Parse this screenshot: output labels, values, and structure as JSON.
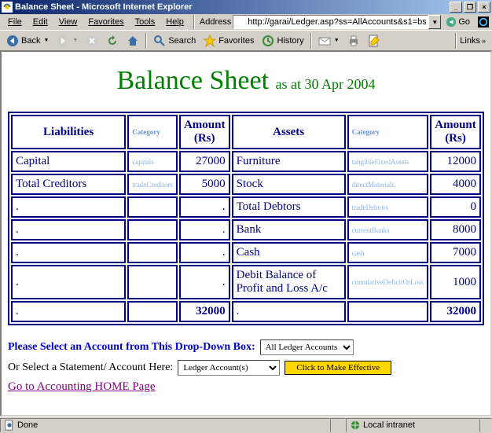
{
  "window": {
    "title": "Balance Sheet - Microsoft Internet Explorer",
    "min": "_",
    "max": "❐",
    "close": "×"
  },
  "menu": {
    "file": "File",
    "edit": "Edit",
    "view": "View",
    "favorites": "Favorites",
    "tools": "Tools",
    "help": "Help"
  },
  "address": {
    "label": "Address",
    "value": "http://garai/Ledger.asp?ss=AllAccounts&s1=bs",
    "go": "Go",
    "links": "Links"
  },
  "toolbar": {
    "back": "Back",
    "search": "Search",
    "favorites": "Favorites",
    "history": "History"
  },
  "page": {
    "heading_main": "Balance Sheet",
    "heading_sub": " as at 30 Apr 2004"
  },
  "table": {
    "hdr_liab": "Liabilities",
    "hdr_cat": "Category",
    "hdr_amt": "Amount (Rs)",
    "hdr_assets": "Assets",
    "rows": {
      "r0": {
        "liab": "Capital",
        "lcat": "capitals",
        "lamt": "27000",
        "asset": "Furniture",
        "acat": "tangibleFixedAssets",
        "aamt": "12000"
      },
      "r1": {
        "liab": "Total Creditors",
        "lcat": "tradeCreditors",
        "lamt": "5000",
        "asset": "Stock",
        "acat": "directMaterials",
        "aamt": "4000"
      },
      "r2": {
        "liab": ".",
        "lcat": "",
        "lamt": ".",
        "asset": "Total Debtors",
        "acat": "tradeDebtors",
        "aamt": "0"
      },
      "r3": {
        "liab": ".",
        "lcat": "",
        "lamt": ".",
        "asset": "Bank",
        "acat": "currentBanks",
        "aamt": "8000"
      },
      "r4": {
        "liab": ".",
        "lcat": "",
        "lamt": ".",
        "asset": "Cash",
        "acat": "cash",
        "aamt": "7000"
      },
      "r5": {
        "liab": ".",
        "lcat": "",
        "lamt": ".",
        "asset": "Debit Balance of Profit and Loss A/c",
        "acat": "cumulativeDeficitOrLoss",
        "aamt": "1000"
      }
    },
    "total": {
      "liab": ".",
      "lamt": "32000",
      "asset": ".",
      "aamt": "32000"
    }
  },
  "form": {
    "select_label": "Please Select an Account from This Drop-Down Box:",
    "select_value": "All Ledger Accounts",
    "stmt_label": "Or Select a Statement/ Account Here:",
    "stmt_value": "Ledger Account(s)",
    "eff_btn": "Click to Make Effective",
    "home_link": "Go to Accounting HOME Page"
  },
  "status": {
    "done": "Done",
    "zone": "Local intranet"
  }
}
